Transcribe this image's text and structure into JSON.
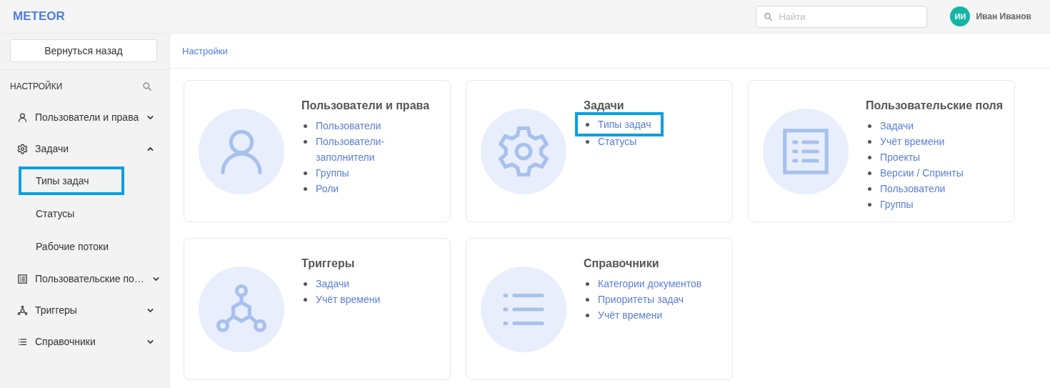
{
  "header": {
    "logo": "METEOR",
    "search": {
      "placeholder": "Найти"
    },
    "user": {
      "initials": "ИИ",
      "name": "Иван Иванов"
    }
  },
  "sidebar": {
    "back_button": "Вернуться назад",
    "title": "НАСТРОЙКИ",
    "items": [
      {
        "label": "Пользователи и права",
        "expanded": false
      },
      {
        "label": "Задачи",
        "expanded": true,
        "children": [
          {
            "label": "Типы задач",
            "highlighted": true
          },
          {
            "label": "Статусы",
            "highlighted": false
          },
          {
            "label": "Рабочие потоки",
            "highlighted": false
          }
        ]
      },
      {
        "label": "Пользовательские по…",
        "expanded": false
      },
      {
        "label": "Триггеры",
        "expanded": false
      },
      {
        "label": "Справочники",
        "expanded": false
      }
    ]
  },
  "breadcrumb": "Настройки",
  "cards": [
    {
      "title": "Пользователи и права",
      "links": [
        {
          "label": "Пользователи",
          "highlighted": false
        },
        {
          "label": "Пользователи-заполнители",
          "highlighted": false
        },
        {
          "label": "Группы",
          "highlighted": false
        },
        {
          "label": "Роли",
          "highlighted": false
        }
      ]
    },
    {
      "title": "Задачи",
      "links": [
        {
          "label": "Типы задач",
          "highlighted": true
        },
        {
          "label": "Статусы",
          "highlighted": false
        }
      ]
    },
    {
      "title": "Пользовательские поля",
      "links": [
        {
          "label": "Задачи",
          "highlighted": false
        },
        {
          "label": "Учёт времени",
          "highlighted": false
        },
        {
          "label": "Проекты",
          "highlighted": false
        },
        {
          "label": "Версии / Спринты",
          "highlighted": false
        },
        {
          "label": "Пользователи",
          "highlighted": false
        },
        {
          "label": "Группы",
          "highlighted": false
        }
      ]
    },
    {
      "title": "Триггеры",
      "links": [
        {
          "label": "Задачи",
          "highlighted": false
        },
        {
          "label": "Учёт времени",
          "highlighted": false
        }
      ]
    },
    {
      "title": "Справочники",
      "links": [
        {
          "label": "Категории документов",
          "highlighted": false
        },
        {
          "label": "Приоритеты задач",
          "highlighted": false
        },
        {
          "label": "Учёт времени",
          "highlighted": false
        }
      ]
    }
  ]
}
